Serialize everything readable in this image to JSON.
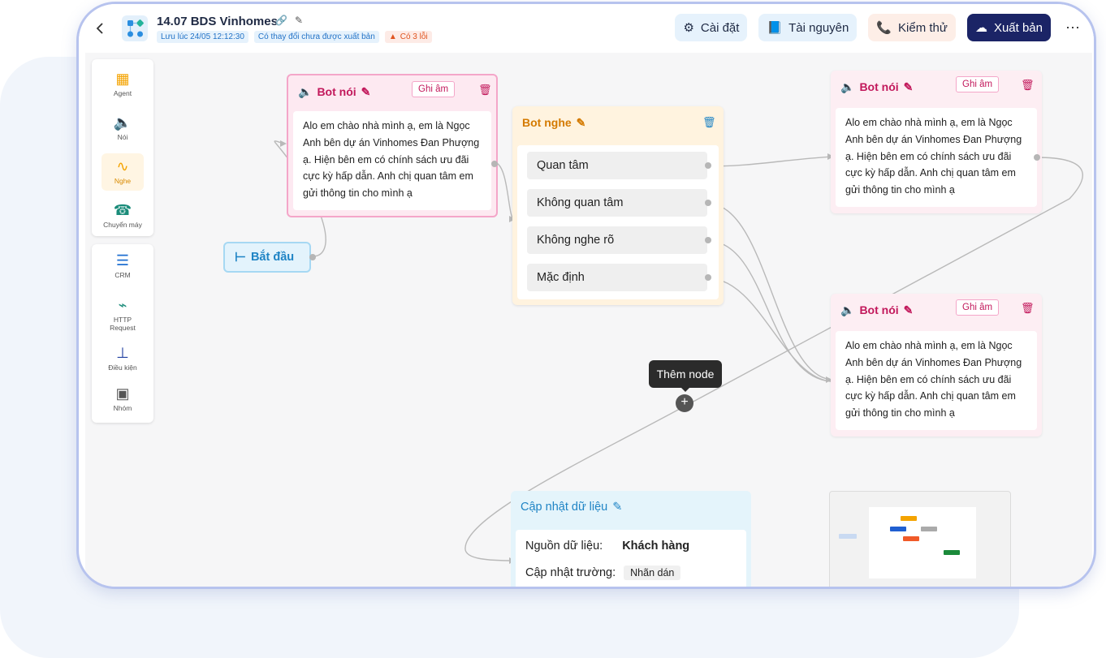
{
  "header": {
    "title": "14.07 BDS Vinhomes",
    "saved_at": "Lưu lúc 24/05 12:12:30",
    "unpublished_note": "Có thay đổi chưa được xuất bản",
    "error_count": "Có 3 lỗi",
    "buttons": {
      "settings": "Cài đặt",
      "resources": "Tài nguyên",
      "test": "Kiểm thử",
      "publish": "Xuất bản"
    },
    "more": "⋯"
  },
  "palette": {
    "items": [
      {
        "label": "Agent",
        "icon": "robot-icon",
        "color": "#f4a300"
      },
      {
        "label": "Nói",
        "icon": "speaker-icon",
        "color": "#c2185b"
      },
      {
        "label": "Nghe",
        "icon": "waveform-icon",
        "color": "#f4a300"
      },
      {
        "label": "Chuyển máy",
        "icon": "phone-forward-icon",
        "color": "#1b8c7a"
      }
    ],
    "items2": [
      {
        "label": "CRM",
        "icon": "database-icon",
        "color": "#1f6fd1"
      },
      {
        "label": "HTTP Request",
        "icon": "plug-icon",
        "color": "#1b8c7a"
      },
      {
        "label": "Điều kiện",
        "icon": "hierarchy-icon",
        "color": "#1f3fa0"
      },
      {
        "label": "Nhóm",
        "icon": "group-icon",
        "color": "#555555"
      }
    ]
  },
  "nodes": {
    "start": {
      "label": "Bắt đầu"
    },
    "bot_noi_1": {
      "title": "Bot nói",
      "record": "Ghi âm",
      "text": "Alo em chào nhà mình ạ, em là Ngọc Anh bên dự án Vinhomes Đan Phượng ạ. Hiện bên em có chính sách ưu đãi cực kỳ hấp dẫn. Anh chị quan tâm em gửi thông tin cho mình ạ"
    },
    "bot_nghe": {
      "title": "Bot nghe",
      "options": [
        "Quan tâm",
        "Không quan tâm",
        "Không nghe rõ",
        "Mặc định"
      ]
    },
    "bot_noi_2": {
      "title": "Bot nói",
      "record": "Ghi âm",
      "text": "Alo em chào nhà mình ạ, em là Ngọc Anh bên dự án Vinhomes Đan Phượng ạ. Hiện bên em có chính sách ưu đãi cực kỳ hấp dẫn. Anh chị quan tâm em gửi thông tin cho mình ạ"
    },
    "bot_noi_3": {
      "title": "Bot nói",
      "record": "Ghi âm",
      "text": "Alo em chào nhà mình ạ, em là Ngọc Anh bên dự án Vinhomes Đan Phượng ạ. Hiện bên em có chính sách ưu đãi cực kỳ hấp dẫn. Anh chị quan tâm em gửi thông tin cho mình ạ"
    },
    "update": {
      "title": "Cập nhật dữ liệu",
      "source_label": "Nguồn dữ liệu:",
      "source_value": "Khách hàng",
      "field_label": "Cập nhật trường:",
      "field_value": "Nhãn dán"
    }
  },
  "tooltip": "Thêm node",
  "add_symbol": "+",
  "colors": {
    "publish_bg": "#1b2466",
    "speak": "#c2185b",
    "listen": "#d47a00",
    "update": "#1f84c5"
  }
}
